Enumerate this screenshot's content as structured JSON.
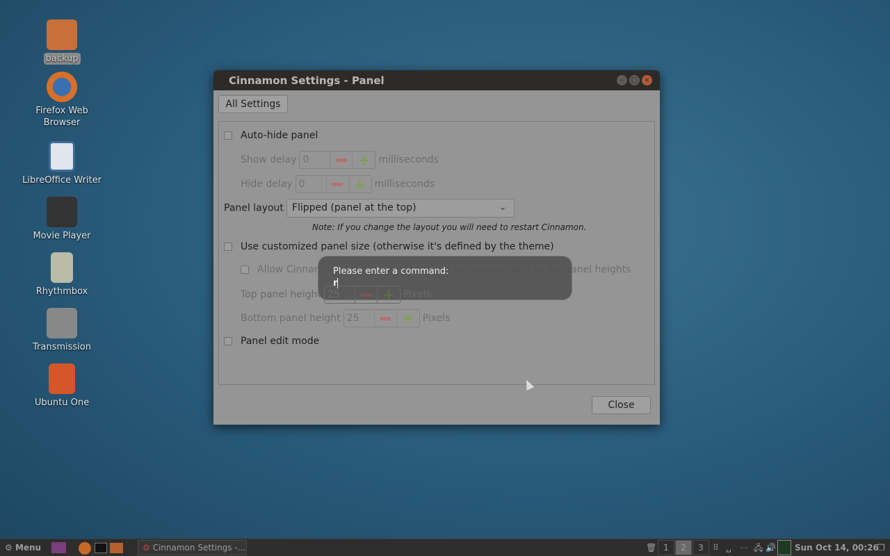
{
  "desktop": {
    "icons": [
      {
        "label": "backup",
        "icon": "folder-icon",
        "color": "#c8703a"
      },
      {
        "label": "Firefox Web Browser",
        "icon": "firefox-icon",
        "color": "#d9702a"
      },
      {
        "label": "LibreOffice Writer",
        "icon": "writer-document-icon",
        "color": "#3d6a9a"
      },
      {
        "label": "Movie Player",
        "icon": "clapperboard-icon",
        "color": "#333333"
      },
      {
        "label": "Rhythmbox",
        "icon": "speaker-icon",
        "color": "#bbbbaa"
      },
      {
        "label": "Transmission",
        "icon": "transmission-icon",
        "color": "#888888"
      },
      {
        "label": "Ubuntu One",
        "icon": "ubuntu-one-icon",
        "color": "#d4572a"
      }
    ]
  },
  "window": {
    "title": "Cinnamon Settings - Panel",
    "all_settings": "All Settings",
    "close": "Close",
    "auto_hide": {
      "label": "Auto-hide panel",
      "checked": false
    },
    "show_delay": {
      "label": "Show delay",
      "value": "0",
      "unit": "milliseconds"
    },
    "hide_delay": {
      "label": "Hide delay",
      "value": "0",
      "unit": "milliseconds"
    },
    "panel_layout": {
      "label": "Panel layout",
      "value": "Flipped (panel at the top)"
    },
    "note": "Note: If you change the layout you will need to restart Cinnamon.",
    "custom_size": {
      "label": "Use customized panel size (otherwise it's defined by the theme)",
      "checked": false
    },
    "allow_scale": {
      "label": "Allow Cinnamon to scale panel text and icons according to the panel heights",
      "checked": false
    },
    "top_height": {
      "label": "Top panel height",
      "value": "25",
      "unit": "Pixels"
    },
    "bottom_height": {
      "label": "Bottom panel height",
      "value": "25",
      "unit": "Pixels"
    },
    "edit_mode": {
      "label": "Panel edit mode",
      "checked": false
    }
  },
  "command_dialog": {
    "prompt": "Please enter a command:",
    "value": "r"
  },
  "panel": {
    "menu": "Menu",
    "task": "Cinnamon Settings -...",
    "workspaces": [
      "1",
      "2",
      "3"
    ],
    "active_workspace": "2",
    "clock": "Sun Oct 14, 00:26"
  }
}
